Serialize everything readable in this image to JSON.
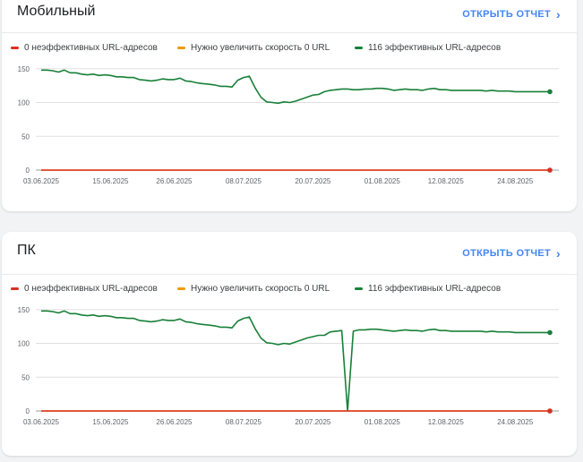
{
  "cards": [
    {
      "title": "Мобильный",
      "open_report": "ОТКРЫТЬ ОТЧЕТ",
      "legend": [
        {
          "label": "0 неэффективных URL-адресов",
          "color": "#d93025"
        },
        {
          "label": "Нужно увеличить скорость 0 URL",
          "color": "#f29900"
        },
        {
          "label": "116 эффективных URL-адресов",
          "color": "#188038"
        }
      ],
      "chart_data": {
        "type": "line",
        "x": [
          "03.06.2025",
          "04.06.2025",
          "05.06.2025",
          "06.06.2025",
          "07.06.2025",
          "08.06.2025",
          "09.06.2025",
          "10.06.2025",
          "11.06.2025",
          "12.06.2025",
          "13.06.2025",
          "14.06.2025",
          "15.06.2025",
          "16.06.2025",
          "17.06.2025",
          "18.06.2025",
          "19.06.2025",
          "20.06.2025",
          "21.06.2025",
          "22.06.2025",
          "23.06.2025",
          "24.06.2025",
          "25.06.2025",
          "26.06.2025",
          "27.06.2025",
          "28.06.2025",
          "29.06.2025",
          "30.06.2025",
          "01.07.2025",
          "02.07.2025",
          "03.07.2025",
          "04.07.2025",
          "05.07.2025",
          "06.07.2025",
          "07.07.2025",
          "08.07.2025",
          "09.07.2025",
          "10.07.2025",
          "11.07.2025",
          "12.07.2025",
          "13.07.2025",
          "14.07.2025",
          "15.07.2025",
          "16.07.2025",
          "17.07.2025",
          "18.07.2025",
          "19.07.2025",
          "20.07.2025",
          "21.07.2025",
          "22.07.2025",
          "23.07.2025",
          "24.07.2025",
          "25.07.2025",
          "26.07.2025",
          "27.07.2025",
          "28.07.2025",
          "29.07.2025",
          "30.07.2025",
          "31.07.2025",
          "01.08.2025",
          "02.08.2025",
          "03.08.2025",
          "04.08.2025",
          "05.08.2025",
          "06.08.2025",
          "07.08.2025",
          "08.08.2025",
          "09.08.2025",
          "10.08.2025",
          "11.08.2025",
          "12.08.2025",
          "13.08.2025",
          "14.08.2025",
          "15.08.2025",
          "16.08.2025",
          "17.08.2025",
          "18.08.2025",
          "19.08.2025",
          "20.08.2025",
          "21.08.2025",
          "22.08.2025",
          "23.08.2025",
          "24.08.2025",
          "25.08.2025",
          "26.08.2025",
          "27.08.2025",
          "28.08.2025",
          "29.08.2025",
          "30.08.2025"
        ],
        "series": [
          {
            "name": "116 эффективных URL-адресов",
            "color": "#188038",
            "values": [
              148,
              148,
              147,
              145,
              148,
              144,
              144,
              142,
              141,
              142,
              140,
              141,
              140,
              138,
              138,
              137,
              137,
              134,
              133,
              132,
              133,
              135,
              134,
              134,
              136,
              132,
              131,
              129,
              128,
              127,
              126,
              124,
              124,
              123,
              133,
              137,
              139,
              122,
              108,
              101,
              100,
              99,
              101,
              100,
              102,
              105,
              108,
              111,
              112,
              116,
              118,
              119,
              120,
              120,
              119,
              119,
              120,
              120,
              121,
              121,
              120,
              118,
              119,
              120,
              119,
              119,
              118,
              120,
              121,
              119,
              119,
              118,
              118,
              118,
              118,
              118,
              118,
              117,
              118,
              117,
              117,
              117,
              116,
              116,
              116,
              116,
              116,
              116,
              116
            ]
          },
          {
            "name": "Нужно увеличить скорость 0 URL",
            "color": "#f29900",
            "values": "zeros"
          },
          {
            "name": "0 неэффективных URL-адресов",
            "color": "#d93025",
            "values": "zeros"
          }
        ],
        "x_tick_labels": [
          "03.06.2025",
          "15.06.2025",
          "26.06.2025",
          "08.07.2025",
          "20.07.2025",
          "01.08.2025",
          "12.08.2025",
          "24.08.2025"
        ],
        "y_ticks": [
          0,
          50,
          100,
          150
        ],
        "ylim": [
          0,
          155
        ]
      }
    },
    {
      "title": "ПК",
      "open_report": "ОТКРЫТЬ ОТЧЕТ",
      "legend": [
        {
          "label": "0 неэффективных URL-адресов",
          "color": "#d93025"
        },
        {
          "label": "Нужно увеличить скорость 0 URL",
          "color": "#f29900"
        },
        {
          "label": "116 эффективных URL-адресов",
          "color": "#188038"
        }
      ],
      "chart_data": {
        "type": "line",
        "x": [
          "03.06.2025",
          "04.06.2025",
          "05.06.2025",
          "06.06.2025",
          "07.06.2025",
          "08.06.2025",
          "09.06.2025",
          "10.06.2025",
          "11.06.2025",
          "12.06.2025",
          "13.06.2025",
          "14.06.2025",
          "15.06.2025",
          "16.06.2025",
          "17.06.2025",
          "18.06.2025",
          "19.06.2025",
          "20.06.2025",
          "21.06.2025",
          "22.06.2025",
          "23.06.2025",
          "24.06.2025",
          "25.06.2025",
          "26.06.2025",
          "27.06.2025",
          "28.06.2025",
          "29.06.2025",
          "30.06.2025",
          "01.07.2025",
          "02.07.2025",
          "03.07.2025",
          "04.07.2025",
          "05.07.2025",
          "06.07.2025",
          "07.07.2025",
          "08.07.2025",
          "09.07.2025",
          "10.07.2025",
          "11.07.2025",
          "12.07.2025",
          "13.07.2025",
          "14.07.2025",
          "15.07.2025",
          "16.07.2025",
          "17.07.2025",
          "18.07.2025",
          "19.07.2025",
          "20.07.2025",
          "21.07.2025",
          "22.07.2025",
          "23.07.2025",
          "24.07.2025",
          "25.07.2025",
          "26.07.2025",
          "27.07.2025",
          "28.07.2025",
          "29.07.2025",
          "30.07.2025",
          "31.07.2025",
          "01.08.2025",
          "02.08.2025",
          "03.08.2025",
          "04.08.2025",
          "05.08.2025",
          "06.08.2025",
          "07.08.2025",
          "08.08.2025",
          "09.08.2025",
          "10.08.2025",
          "11.08.2025",
          "12.08.2025",
          "13.08.2025",
          "14.08.2025",
          "15.08.2025",
          "16.08.2025",
          "17.08.2025",
          "18.08.2025",
          "19.08.2025",
          "20.08.2025",
          "21.08.2025",
          "22.08.2025",
          "23.08.2025",
          "24.08.2025",
          "25.08.2025",
          "26.08.2025",
          "27.08.2025",
          "28.08.2025",
          "29.08.2025",
          "30.08.2025"
        ],
        "series": [
          {
            "name": "116 эффективных URL-адресов",
            "color": "#188038",
            "values": [
              148,
              148,
              147,
              145,
              148,
              144,
              144,
              142,
              141,
              142,
              140,
              141,
              140,
              138,
              138,
              137,
              137,
              134,
              133,
              132,
              133,
              135,
              134,
              134,
              136,
              132,
              131,
              129,
              128,
              127,
              126,
              124,
              124,
              123,
              133,
              137,
              139,
              122,
              108,
              101,
              100,
              98,
              100,
              99,
              102,
              105,
              108,
              110,
              112,
              112,
              117,
              118,
              119,
              0,
              118,
              120,
              120,
              121,
              121,
              120,
              119,
              118,
              119,
              120,
              119,
              119,
              118,
              120,
              121,
              119,
              119,
              118,
              118,
              118,
              118,
              118,
              118,
              117,
              118,
              117,
              117,
              117,
              116,
              116,
              116,
              116,
              116,
              116,
              116
            ]
          },
          {
            "name": "Нужно увеличить скорость 0 URL",
            "color": "#f29900",
            "values": "zeros"
          },
          {
            "name": "0 неэффективных URL-адресов",
            "color": "#d93025",
            "values": "zeros"
          }
        ],
        "x_tick_labels": [
          "03.06.2025",
          "15.06.2025",
          "26.06.2025",
          "08.07.2025",
          "20.07.2025",
          "01.08.2025",
          "12.08.2025",
          "24.08.2025"
        ],
        "y_ticks": [
          0,
          50,
          100,
          150
        ],
        "ylim": [
          0,
          155
        ]
      }
    }
  ]
}
